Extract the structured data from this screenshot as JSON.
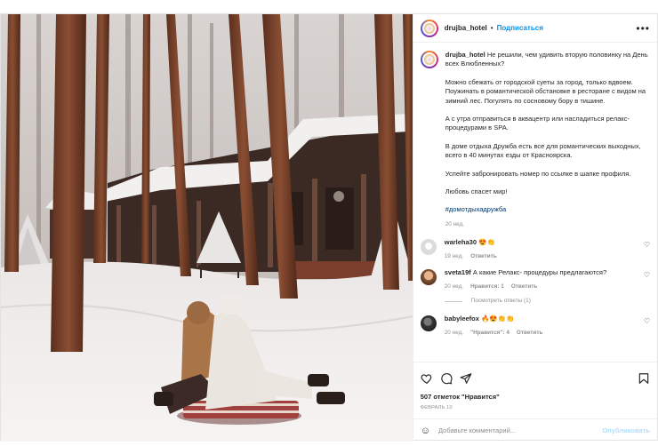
{
  "header": {
    "username": "drujba_hotel",
    "separator": "•",
    "follow_label": "Подписаться",
    "more_icon": "more-horizontal-icon"
  },
  "caption": {
    "username": "drujba_hotel",
    "paragraphs": [
      "Не решили, чем удивить вторую половинку на День всех Влюбленных?",
      "Можно сбежать от городской суеты за город, только вдвоем. Поужинать в романтической обстановке в ресторане с видом на зимний лес. Погулять по сосновому бору в тишине.",
      "А с утра отправиться в аквацентр или насладиться релакс-процедурами в SPA.",
      "В доме отдыха Дружба есть все для романтических выходных, всего в 40 минутах езды от Красноярска.",
      "Успейте забронировать номер по ссылке в шапке профиля.",
      "Любовь спасет мир!"
    ],
    "hashtag": "#домотдыхадружба",
    "time": "20 нед."
  },
  "comments": [
    {
      "username": "warleha30",
      "text": "😍👏",
      "time": "19 нед.",
      "likes": "",
      "reply": "Ответить"
    },
    {
      "username": "sveta19f",
      "text": "А какие Релакс- процедуры предлагаются?",
      "time": "20 нед.",
      "likes": "Нравится: 1",
      "reply": "Ответить",
      "view_replies": "Посмотреть ответы (1)"
    },
    {
      "username": "babyleefox",
      "text": "🔥😍👏👏",
      "time": "20 нед.",
      "likes": "\"Нравится\": 4",
      "reply": "Ответить"
    }
  ],
  "actions": {
    "likes": "507 отметок \"Нравится\"",
    "date": "ФЕВРАЛЬ 10",
    "icons": [
      "heart-icon",
      "comment-icon",
      "share-icon",
      "bookmark-icon"
    ]
  },
  "add_comment": {
    "placeholder": "Добавьте комментарий...",
    "publish_label": "Опубликовать",
    "emoji_icon": "emoji-icon"
  },
  "colors": {
    "link": "#0095f6",
    "hashtag": "#00376b",
    "muted": "#8e8e8e",
    "publish_disabled": "#b2dffc"
  }
}
